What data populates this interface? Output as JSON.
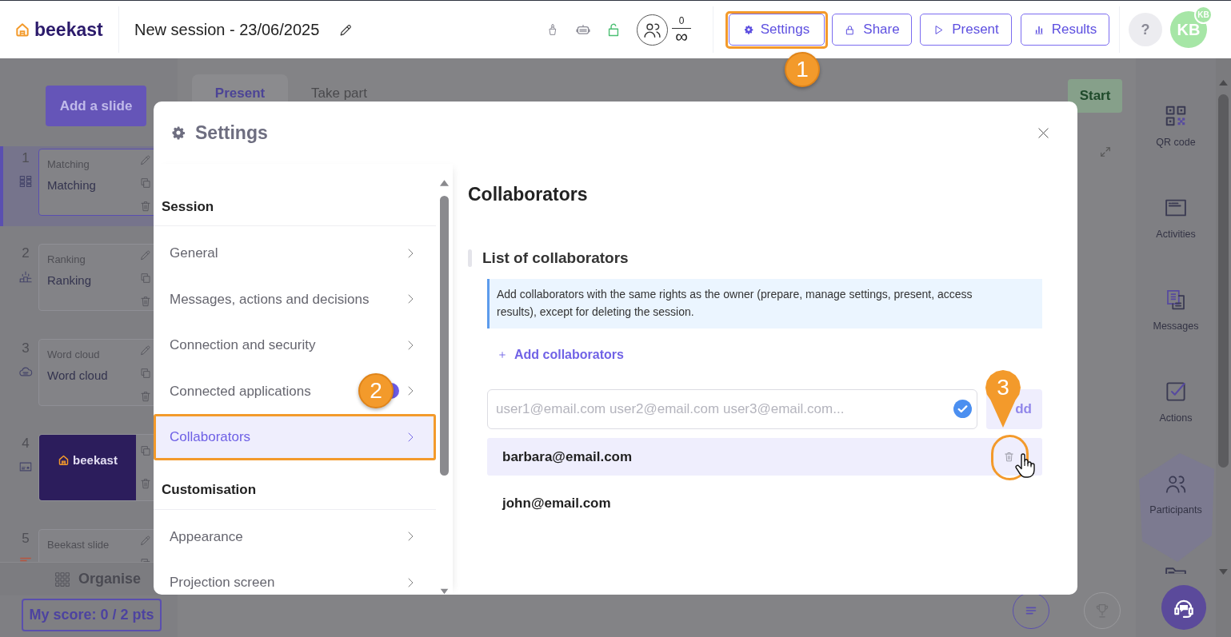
{
  "header": {
    "logo": "beekast",
    "title": "New session - 23/06/2025",
    "participants": {
      "count": "0",
      "limit": "∞"
    },
    "buttons": [
      {
        "label": "Settings",
        "kind": "settings",
        "highlighted": true,
        "callout": "1"
      },
      {
        "label": "Share",
        "kind": "share",
        "highlighted": false
      },
      {
        "label": "Present",
        "kind": "present",
        "highlighted": false
      },
      {
        "label": "Results",
        "kind": "results",
        "highlighted": false
      }
    ],
    "help": "?",
    "avatar": {
      "initials": "KB",
      "badge": "KB"
    }
  },
  "slides_panel": {
    "add_button": "Add a slide",
    "slides": [
      {
        "number": "1",
        "kind": "matching",
        "type": "Matching",
        "title": "Matching",
        "selected": true
      },
      {
        "number": "2",
        "kind": "ranking",
        "type": "Ranking",
        "title": "Ranking",
        "selected": false
      },
      {
        "number": "3",
        "kind": "word_cloud",
        "type": "Word cloud",
        "title": "Word cloud",
        "selected": false
      },
      {
        "number": "4",
        "kind": "image",
        "logo": "beekast",
        "selected": false
      },
      {
        "number": "5",
        "kind": "slide",
        "type": "Beekast slide",
        "selected": false
      }
    ],
    "organise": "Organise",
    "score": "My score: 0 / 2 pts"
  },
  "stage": {
    "tabs": [
      {
        "label": "Present",
        "selected": true
      },
      {
        "label": "Take part",
        "selected": false
      }
    ],
    "start_button": "Start"
  },
  "tools": [
    {
      "label": "QR code",
      "kind": "qr"
    },
    {
      "label": "Activities",
      "kind": "activities"
    },
    {
      "label": "Messages",
      "kind": "messages"
    },
    {
      "label": "Actions",
      "kind": "actions"
    },
    {
      "label": "Participants",
      "kind": "participants"
    },
    {
      "kind": "folder"
    }
  ],
  "settings_dialog": {
    "title": "Settings",
    "menu": [
      {
        "heading": "Session",
        "items": [
          {
            "label": "General",
            "selected": false,
            "highlighted": false,
            "badge": false
          },
          {
            "label": "Messages, actions and decisions",
            "selected": false,
            "highlighted": false,
            "badge": false
          },
          {
            "label": "Connection and security",
            "selected": false,
            "highlighted": false,
            "badge": false
          },
          {
            "label": "Connected applications",
            "selected": false,
            "highlighted": false,
            "badge": true,
            "callout": "2"
          },
          {
            "label": "Collaborators",
            "selected": true,
            "highlighted": true,
            "badge": false
          }
        ]
      },
      {
        "heading": "Customisation",
        "items": [
          {
            "label": "Appearance",
            "selected": false,
            "highlighted": false,
            "badge": false
          },
          {
            "label": "Projection screen",
            "selected": false,
            "highlighted": false,
            "badge": false
          }
        ]
      }
    ],
    "content": {
      "title": "Collaborators",
      "section": "List of collaborators",
      "info": "Add collaborators with the same rights as the owner (prepare, manage settings, present, access results), except for deleting the session.",
      "add_link": "Add collaborators",
      "input": {
        "placeholder": "user1@email.com user2@email.com user3@email.com...",
        "validated": true
      },
      "add_button": {
        "label": "dd",
        "disabled": true
      },
      "collaborators": [
        {
          "email": "barbara@email.com",
          "hovered": true,
          "highlighted": true,
          "callout": "3"
        },
        {
          "email": "john@email.com",
          "hovered": false,
          "highlighted": false
        }
      ]
    }
  }
}
